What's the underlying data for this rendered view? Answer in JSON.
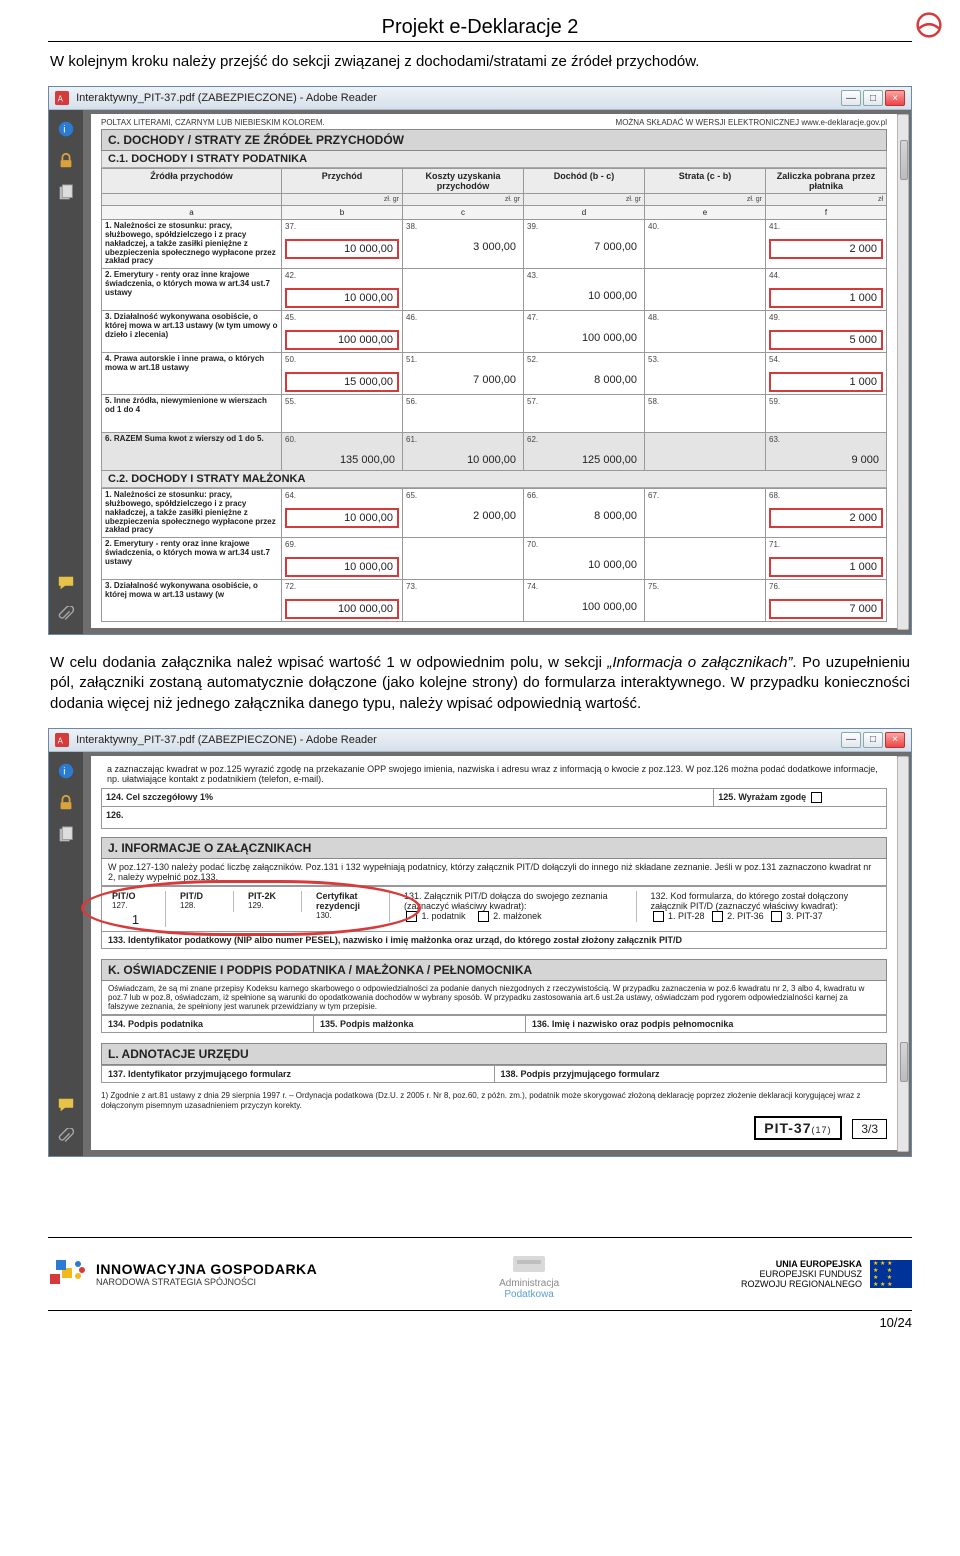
{
  "doc": {
    "title": "Projekt e-Deklaracje 2",
    "p1": "W kolejnym kroku należy przejść do sekcji związanej z dochodami/stratami ze źródeł przychodów.",
    "p2_a": "W celu dodania załącznika należ wpisać wartość 1 w odpowiednim polu, w sekcji ",
    "p2_italic": "„Informacja o załącznikach”",
    "p2_b": ". Po uzupełnieniu pól, załączniki zostaną automatycznie dołączone (jako kolejne strony) do formularza interaktywnego. W przypadku konieczności dodania więcej niż jednego załącznika danego typu, należy wpisać odpowiednią wartość.",
    "page_counter": "10/24"
  },
  "win": {
    "title": "Interaktywny_PIT-37.pdf (ZABEZPIECZONE) - Adobe Reader",
    "topstrip_left": "POLTAX      LITERAMI, CZARNYM LUB NIEBIESKIM KOLOREM.",
    "topstrip_right": "MOŻNA SKŁADAĆ W WERSJI ELEKTRONICZNEJ   www.e-deklaracje.gov.pl"
  },
  "form": {
    "secC": "C. DOCHODY / STRATY ZE ŹRÓDEŁ PRZYCHODÓW",
    "secC1": "C.1. DOCHODY I STRATY PODATNIKA",
    "secC2": "C.2. DOCHODY I STRATY MAŁŻONKA",
    "headers": [
      "Źródła przychodów",
      "Przychód",
      "Koszty uzyskania przychodów",
      "Dochód (b - c)",
      "Strata (c - b)",
      "Zaliczka pobrana przez płatnika"
    ],
    "sub": [
      "",
      "zł.   gr",
      "zł.   gr",
      "zł.   gr",
      "zł.   gr",
      "zł"
    ],
    "lettercols": [
      "a",
      "b",
      "c",
      "d",
      "e",
      "f"
    ],
    "rows": [
      {
        "label": "1. Należności ze stosunku: pracy, służbowego, spółdzielczego i z pracy nakładczej, a także zasiłki pieniężne z ubezpieczenia społecznego wypłacone przez zakład pracy",
        "nums": [
          "37.",
          "38.",
          "39.",
          "40.",
          "41."
        ],
        "vals": [
          "10 000,00",
          "3 000,00",
          "7 000,00",
          "",
          "2 000"
        ],
        "red": [
          1,
          5
        ]
      },
      {
        "label": "2. Emerytury - renty oraz inne krajowe świadczenia, o których mowa w art.34 ust.7 ustawy",
        "nums": [
          "42.",
          "",
          "43.",
          "",
          "44."
        ],
        "vals": [
          "10 000,00",
          "",
          "10 000,00",
          "",
          "1 000"
        ],
        "red": [
          1,
          5
        ]
      },
      {
        "label": "3. Działalność wykonywana osobiście, o której mowa w art.13 ustawy (w tym umowy o dzieło i zlecenia)",
        "nums": [
          "45.",
          "46.",
          "47.",
          "48.",
          "49."
        ],
        "vals": [
          "100 000,00",
          "",
          "100 000,00",
          "",
          "5 000"
        ],
        "red": [
          1,
          5
        ]
      },
      {
        "label": "4. Prawa autorskie i inne prawa, o których mowa w art.18 ustawy",
        "nums": [
          "50.",
          "51.",
          "52.",
          "53.",
          "54."
        ],
        "vals": [
          "15 000,00",
          "7 000,00",
          "8 000,00",
          "",
          "1 000"
        ],
        "red": [
          1,
          5
        ]
      },
      {
        "label": "5. Inne źródła, niewymienione w wierszach od 1 do 4",
        "nums": [
          "55.",
          "56.",
          "57.",
          "58.",
          "59."
        ],
        "vals": [
          "",
          "",
          "",
          "",
          ""
        ],
        "red": []
      },
      {
        "label": "6. RAZEM   Suma kwot z wierszy od 1 do 5.",
        "nums": [
          "60.",
          "61.",
          "62.",
          "",
          "63."
        ],
        "vals": [
          "135 000,00",
          "10 000,00",
          "125 000,00",
          "",
          "9 000"
        ],
        "red": [],
        "sum": true
      }
    ],
    "rows2": [
      {
        "label": "1. Należności ze stosunku: pracy, służbowego, spółdzielczego i z pracy nakładczej, a także zasiłki pieniężne z ubezpieczenia społecznego wypłacone przez zakład pracy",
        "nums": [
          "64.",
          "65.",
          "66.",
          "67.",
          "68."
        ],
        "vals": [
          "10 000,00",
          "2 000,00",
          "8 000,00",
          "",
          "2 000"
        ],
        "red": [
          1,
          5
        ]
      },
      {
        "label": "2. Emerytury - renty oraz inne krajowe świadczenia, o których mowa w art.34 ust.7 ustawy",
        "nums": [
          "69.",
          "",
          "70.",
          "",
          "71."
        ],
        "vals": [
          "10 000,00",
          "",
          "10 000,00",
          "",
          "1 000"
        ],
        "red": [
          1,
          5
        ]
      },
      {
        "label": "3. Działalność wykonywana osobiście, o której mowa w art.13 ustawy (w",
        "nums": [
          "72.",
          "73.",
          "74.",
          "75.",
          "76."
        ],
        "vals": [
          "100 000,00",
          "",
          "100 000,00",
          "",
          "7 000"
        ],
        "red": [
          1,
          5
        ]
      }
    ]
  },
  "form2": {
    "intro": "a zaznaczając kwadrat w poz.125 wyrazić zgodę na przekazanie OPP swojego imienia, nazwiska i adresu wraz z informacją o kwocie z poz.123. W poz.126 można podać dodatkowe informacje, np. ułatwiające kontakt z podatnikiem (telefon, e-mail).",
    "p124": "124. Cel szczegółowy 1%",
    "p125": "125. Wyrażam zgodę",
    "p126": "126.",
    "secJ": "J. INFORMACJE O ZAŁĄCZNIKACH",
    "j_intro": "W poz.127-130 należy podać liczbę załączników. Poz.131 i 132 wypełniają podatnicy, którzy załącznik PIT/D dołączyli do innego niż składane zeznanie. Jeśli w poz.131 zaznaczono kwadrat nr 2, należy wypełnić poz.133.",
    "att": {
      "h": [
        "PIT/O",
        "PIT/D",
        "PIT-2K",
        "Certyfikat rezydencji"
      ],
      "n": [
        "127.",
        "128.",
        "129.",
        "130."
      ],
      "v": [
        "1",
        "",
        "",
        ""
      ]
    },
    "c131": "131. Załącznik PIT/D dołącza do swojego zeznania (zaznaczyć właściwy kwadrat):",
    "c131a": "1. podatnik",
    "c131b": "2. małżonek",
    "c132": "132. Kod formularza, do którego został dołączony załącznik PIT/D (zaznaczyć właściwy kwadrat):",
    "c132a": "1. PIT-28",
    "c132b": "2. PIT-36",
    "c132c": "3. PIT-37",
    "c133": "133. Identyfikator podatkowy (NIP albo numer PESEL), nazwisko i imię małżonka oraz urząd, do którego został złożony załącznik PIT/D",
    "secK": "K. OŚWIADCZENIE I PODPIS PODATNIKA / MAŁŻONKA / PEŁNOMOCNIKA",
    "k_body": "Oświadczam, że są mi znane przepisy Kodeksu karnego skarbowego o odpowiedzialności za podanie danych niezgodnych z rzeczywistością. W przypadku zaznaczenia w poz.6 kwadratu nr 2, 3 albo 4, kwadratu w poz.7 lub w poz.8, oświadczam, iż spełnione są warunki do opodatkowania dochodów w wybrany sposób. W przypadku zastosowania art.6 ust.2a ustawy, oświadczam pod rygorem odpowiedzialności karnej za fałszywe zeznania, że spełniony jest warunek przewidziany w tym przepisie.",
    "k134": "134. Podpis podatnika",
    "k135": "135. Podpis małżonka",
    "k136": "136. Imię i nazwisko oraz podpis pełnomocnika",
    "secL": "L. ADNOTACJE URZĘDU",
    "l137": "137. Identyfikator przyjmującego formularz",
    "l138": "138. Podpis przyjmującego formularz",
    "foot": "1) Zgodnie z art.81 ustawy z dnia 29 sierpnia 1997 r. – Ordynacja podatkowa (Dz.U. z 2005 r. Nr 8, poz.60, z późn. zm.), podatnik może skorygować złożoną deklarację poprzez złożenie deklaracji korygującej wraz z dołączonym pisemnym uzasadnieniem przyczyn korekty.",
    "pit": "PIT-37",
    "pit_sub": "(17)",
    "pg": "3/3"
  },
  "footer": {
    "left1": "INNOWACYJNA GOSPODARKA",
    "left2": "NARODOWA STRATEGIA SPÓJNOŚCI",
    "mid1": "Administracja",
    "mid2": "Podatkowa",
    "r1": "UNIA EUROPEJSKA",
    "r2": "EUROPEJSKI FUNDUSZ",
    "r3": "ROZWOJU REGIONALNEGO"
  }
}
